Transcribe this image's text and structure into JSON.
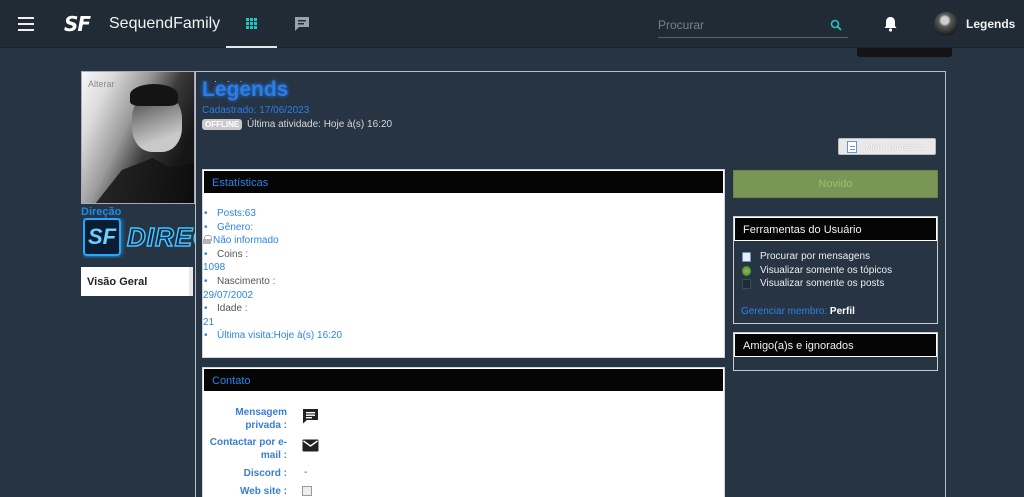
{
  "topbar": {
    "logo_text": "SF",
    "site_name": "SequendFamily",
    "search_placeholder": "Procurar",
    "username": "Legends"
  },
  "sidebar": {
    "avatar_change": "Alterar",
    "rank_title": "Direção",
    "rank_logo_text": "SF",
    "rank_banner_text": "DIREÇ",
    "tab_label": "Visão Geral"
  },
  "profile": {
    "name": "Legends",
    "joined": "Cadastrado: 17/06/2023",
    "status_badge": "OFFLINE",
    "last_activity": "Última atividade: Hoje à(s) 16:20",
    "meu_conteudo": "Meu Conteúdo",
    "status_color": "#c9c9c9",
    "accent_color": "#2b84e8"
  },
  "stats": {
    "title": "Estatísticas",
    "posts_label": "Posts:",
    "posts_value": "63",
    "genero_label": "Gênero:",
    "genero_value": "Não informado",
    "coins_label": "Coins :",
    "coins_value": "1098",
    "nascimento_label": "Nascimento :",
    "nascimento_value": "29/07/2002",
    "idade_label": "Idade :",
    "idade_value": "21",
    "ultima_visita": "Última visita:Hoje à(s) 16:20"
  },
  "contato": {
    "title": "Contato",
    "mensagem_label": "Mensagem privada :",
    "email_label": "Contactar por e-mail :",
    "discord_label": "Discord :",
    "discord_value": "-",
    "website_label": "Web site :"
  },
  "right": {
    "novidade_label": "Novido",
    "novidade_color": "#7a9656",
    "tools_title": "Ferramentas do Usuário",
    "tool_items": [
      "Procurar por mensagens",
      "Visualizar somente os tópicos",
      "Visualizar somente os posts"
    ],
    "gerenciar_label": "Gerenciar membro:",
    "gerenciar_link": "Perfil",
    "amigos_title": "Amigo(a)s e ignorados"
  }
}
